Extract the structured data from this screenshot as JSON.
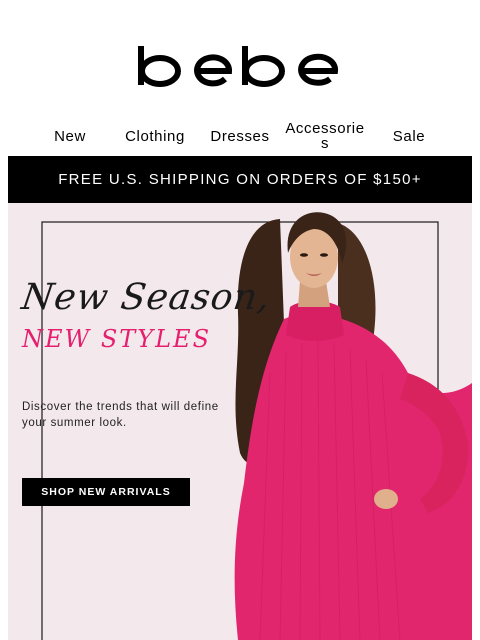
{
  "brand": {
    "logo_text": "bebe"
  },
  "nav": {
    "items": [
      {
        "label": "New"
      },
      {
        "label": "Clothing"
      },
      {
        "label": "Dresses"
      },
      {
        "label": "Accessories"
      },
      {
        "label": "Sale"
      }
    ]
  },
  "promo": {
    "text": "FREE U.S. SHIPPING ON ORDERS OF $150+"
  },
  "hero": {
    "headline_script": "New Season,",
    "headline_caps": "NEW STYLES",
    "subcopy": "Discover the trends that will define your summer look.",
    "cta_label": "SHOP NEW ARRIVALS",
    "accent_color": "#e4206e",
    "background_color": "#f3e8ec"
  }
}
